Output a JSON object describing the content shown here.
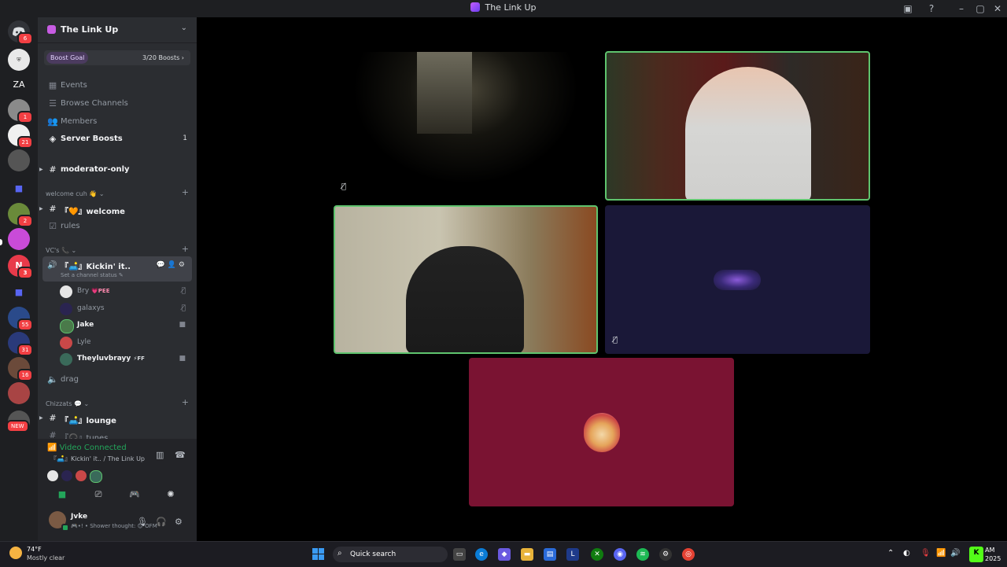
{
  "window": {
    "title": "The Link Up"
  },
  "server_rail": [
    {
      "name": "discord-home",
      "badge": "6"
    },
    {
      "name": "Fortis",
      "badge": ""
    },
    {
      "name": "ZA",
      "badge": ""
    },
    {
      "name": "server-4",
      "badge": "1"
    },
    {
      "name": "server-5",
      "badge": "21"
    },
    {
      "name": "server-6",
      "badge": ""
    },
    {
      "name": "folder-1",
      "badge": ""
    },
    {
      "name": "server-8",
      "badge": "2"
    },
    {
      "name": "server-9",
      "badge": ""
    },
    {
      "name": "N",
      "badge": "3"
    },
    {
      "name": "folder-2",
      "badge": ""
    },
    {
      "name": "server-12",
      "badge": "55"
    },
    {
      "name": "server-13",
      "badge": "31"
    },
    {
      "name": "server-14",
      "badge": "16"
    },
    {
      "name": "server-15",
      "badge": ""
    },
    {
      "name": "server-16",
      "badge": "NEW"
    }
  ],
  "server": {
    "name": "The Link Up",
    "boost_goal_label": "Boost Goal",
    "boost_count": "3/20 Boosts ›"
  },
  "nav": {
    "events": "Events",
    "browse_channels": "Browse Channels",
    "members": "Members",
    "server_boosts": "Server Boosts",
    "server_boosts_count": "1"
  },
  "channels": {
    "moderator_only": "moderator-only",
    "category_welcome": "welcome cuh 👋 ⌄",
    "welcome": "『🧡』welcome",
    "rules": "rules",
    "category_vcs": "VC's 📞 ⌄",
    "vc_active": "『🛋️』Kickin' it..",
    "vc_status": "Set a channel status ✎",
    "members": [
      {
        "name": "Bry",
        "tag": "💗PEE",
        "status_icon": "muted"
      },
      {
        "name": "galaxys",
        "tag": "",
        "status_icon": "muted"
      },
      {
        "name": "Jake",
        "tag": "",
        "status_icon": "video"
      },
      {
        "name": "Lyle",
        "tag": "",
        "status_icon": ""
      },
      {
        "name": "Theyluvbrayy",
        "tag": "⚡FF",
        "status_icon": "video"
      }
    ],
    "drag": "drag",
    "category_chizzats": "Chizzats 💬 ⌄",
    "lounge": "『🛋️』lounge",
    "tunes": "『🎧』tunes"
  },
  "voice_panel": {
    "status": "Video Connected",
    "location": "『🛋️』Kickin' it.. / The Link Up"
  },
  "user": {
    "name": "Jvke",
    "status": "🎮•! • Shower thought: 😊 OFM"
  },
  "taskbar": {
    "temperature": "74°F",
    "weather": "Mostly clear",
    "search_label": "Quick search",
    "clock_time": "AM",
    "clock_date": "2025"
  },
  "colors": {
    "speaking_border": "#5fc46e",
    "accent": "#5865f2",
    "online": "#23a55a",
    "tile_red": "#7a1332",
    "tile_navy": "#1a1838"
  }
}
